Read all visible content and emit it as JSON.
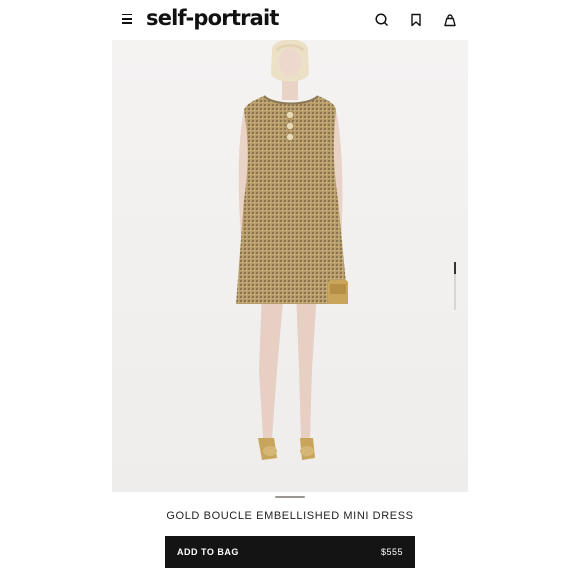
{
  "header": {
    "brand": "self-portrait",
    "menu_icon": "hamburger-menu-icon",
    "search_icon": "search-icon",
    "wishlist_icon": "bookmark-icon",
    "bag_icon": "shopping-bag-icon"
  },
  "gallery": {
    "image_alt": "Model wearing a gold boucle embellished sleeveless mini dress with gold heels",
    "slide_index": 1,
    "slide_count": 4,
    "zoom_icon": "zoom-in-icon",
    "save_icon": "bookmark-icon"
  },
  "product": {
    "name": "GOLD BOUCLE EMBELLISHED MINI DRESS",
    "add_to_bag_label": "ADD TO BAG",
    "price": "$555"
  },
  "colors": {
    "button_bg": "#141414",
    "image_bg": "#f1f0ef",
    "dress": "#b99e6c"
  }
}
